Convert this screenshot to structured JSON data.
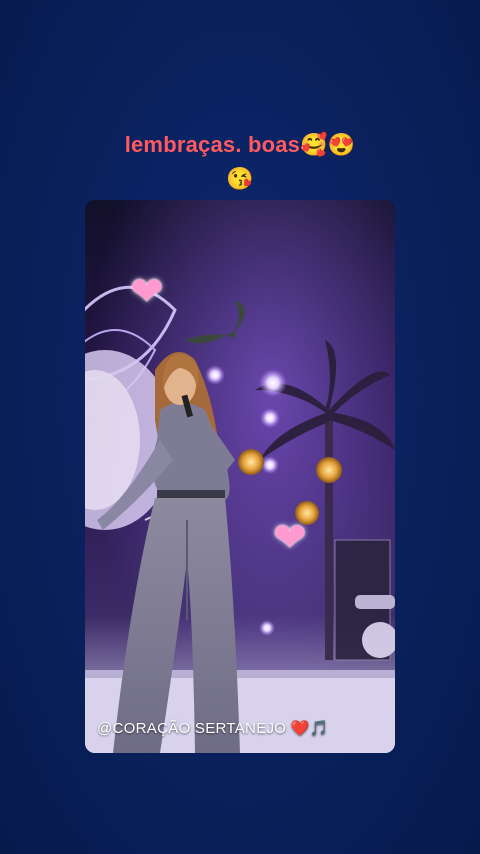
{
  "story": {
    "caption_line1": "lembraças. boas🥰😍",
    "caption_line2": "😘",
    "caption_color": "#ff5a5f",
    "background_color": "#0a2260",
    "mention_text": "@CORAÇÃO SERTANEJO ❤️🎵",
    "stickers": [
      {
        "name": "heart-sticker-top",
        "glyph": "❤"
      },
      {
        "name": "heart-sticker-bottom",
        "glyph": "❤"
      }
    ]
  }
}
